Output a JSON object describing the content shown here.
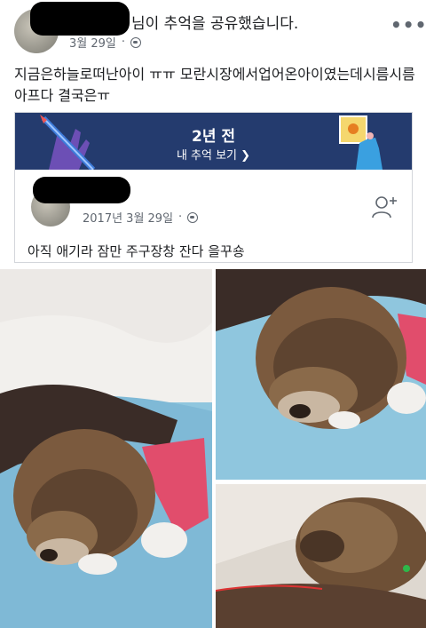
{
  "post": {
    "shared_text": "님이 추억을 공유했습니다.",
    "date": "3월 29일",
    "more": "•••",
    "body": "지금은하늘로떠난아이 ㅠㅠ 모란시장에서업어온아이였는데시름시름아프다 결국은ㅠ"
  },
  "memory": {
    "years_ago": "2년 전",
    "view_label": "내 추억 보기 ❯",
    "date": "2017년 3월 29일",
    "text": "아직 애기라 잠만 주구장창 잔다 을꾸숑"
  },
  "colors": {
    "banner": "#243b6e",
    "meta": "#606770"
  }
}
